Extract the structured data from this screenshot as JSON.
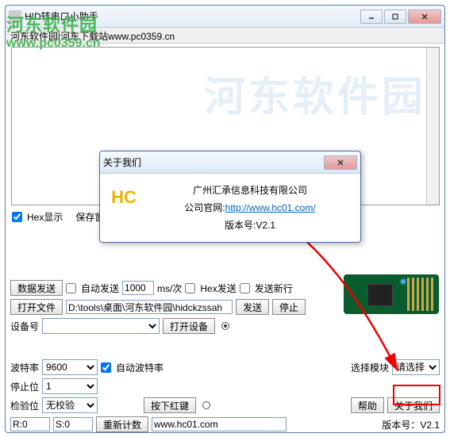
{
  "main": {
    "title": "HID转串口小助手",
    "toolbar_text": "河东软件园|河东下载站www.pc0359.cn"
  },
  "options": {
    "hex_display": "Hex显示",
    "save_window": "保存窗"
  },
  "send": {
    "data_send": "数据发送",
    "auto_send": "自动发送",
    "interval": "1000",
    "interval_unit": "ms/次",
    "hex_send": "Hex发送",
    "send_newline": "发送新行",
    "open_file": "打开文件",
    "file_path": "D:\\tools\\桌面\\河东软件园\\hidckzssah",
    "send_btn": "发送",
    "stop_btn": "停止"
  },
  "device": {
    "device_no": "设备号",
    "open_device": "打开设备"
  },
  "params": {
    "baud": "波特率",
    "baud_val": "9600",
    "auto_baud": "自动波特率",
    "stopbit": "停止位",
    "stopbit_val": "1",
    "check": "检验位",
    "check_val": "无校验",
    "press_red": "按下红键"
  },
  "right": {
    "select_module": "选择模块",
    "select_placeholder": "请选择",
    "help": "帮助",
    "about": "关于我们"
  },
  "status": {
    "r": "R:0",
    "s": "S:0",
    "reset_count": "重新计数",
    "url": "www.hc01.com",
    "version": "版本号：V2.1"
  },
  "dialog": {
    "title": "关于我们",
    "company": "广州汇承信息科技有限公司",
    "website_label": "公司官网:",
    "website_url": "http://www.hc01.com/",
    "version": "版本号:V2.1",
    "logo": "HC"
  },
  "watermark": {
    "line1": "河东软件园",
    "line2": "www.pc0359.cn",
    "bg": "河东软件园"
  }
}
